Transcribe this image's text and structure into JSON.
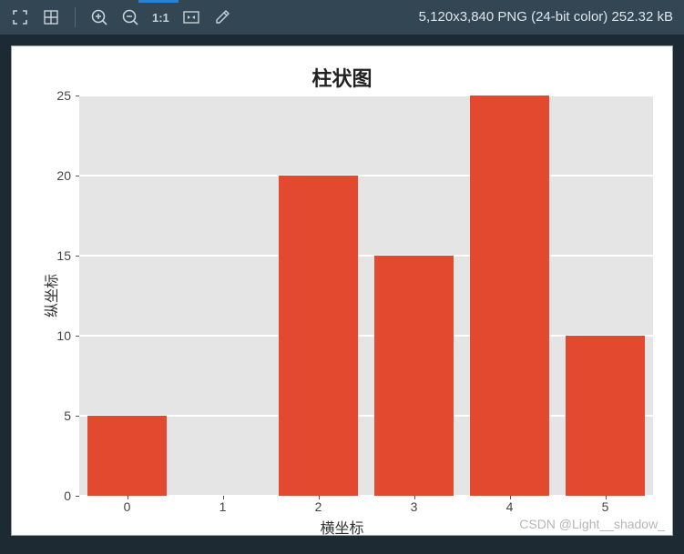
{
  "toolbar": {
    "zoom_ratio_label": "1:1"
  },
  "status_text": "5,120x3,840 PNG (24-bit color) 252.32 kB",
  "watermark": "CSDN @Light__shadow_",
  "chart_data": {
    "type": "bar",
    "title": "柱状图",
    "xlabel": "横坐标",
    "ylabel": "纵坐标",
    "categories": [
      "0",
      "1",
      "2",
      "3",
      "4",
      "5"
    ],
    "values": [
      5,
      0,
      20,
      15,
      25,
      10
    ],
    "ylim": [
      0,
      25
    ],
    "yticks": [
      0,
      5,
      10,
      15,
      20,
      25
    ],
    "bar_color": "#e2492f"
  }
}
